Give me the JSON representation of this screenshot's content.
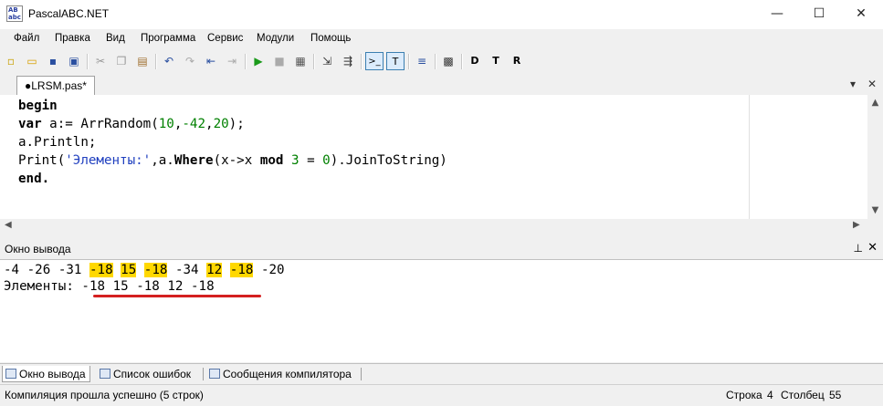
{
  "window": {
    "app_icon_text": "AB abc",
    "title": "PascalABC.NET",
    "minimize_glyph": "—",
    "maximize_glyph": "☐",
    "close_glyph": "✕"
  },
  "menu": [
    "Файл",
    "Правка",
    "Вид",
    "Программа",
    "Сервис",
    "Модули",
    "Помощь"
  ],
  "toolbar": {
    "buttons": [
      {
        "name": "new-file-icon",
        "glyph": "▫"
      },
      {
        "name": "open-file-icon",
        "glyph": "▭"
      },
      {
        "name": "save-icon",
        "glyph": "▪"
      },
      {
        "name": "save-all-icon",
        "glyph": "▣"
      },
      {
        "name": "cut-icon",
        "glyph": "✂"
      },
      {
        "name": "copy-icon",
        "glyph": "❐"
      },
      {
        "name": "paste-icon",
        "glyph": "▤"
      },
      {
        "name": "undo-icon",
        "glyph": "↶"
      },
      {
        "name": "redo-icon",
        "glyph": "↷"
      },
      {
        "name": "navigate-back-icon",
        "glyph": "⇤"
      },
      {
        "name": "navigate-forward-icon",
        "glyph": "⇥"
      },
      {
        "name": "run-icon",
        "glyph": "▶"
      },
      {
        "name": "stop-icon",
        "glyph": "■"
      },
      {
        "name": "compile-icon",
        "glyph": "▦"
      },
      {
        "name": "debug-step-icon",
        "glyph": "⇲"
      },
      {
        "name": "debug-step-over-icon",
        "glyph": "⇶"
      },
      {
        "name": "console-output-icon",
        "glyph": ">_"
      },
      {
        "name": "text-output-icon",
        "glyph": "T"
      },
      {
        "name": "format-code-icon",
        "glyph": "≡"
      },
      {
        "name": "form-designer-icon",
        "glyph": "▩"
      },
      {
        "name": "file-d-icon",
        "glyph": "D"
      },
      {
        "name": "file-t-icon",
        "glyph": "T"
      },
      {
        "name": "file-r-icon",
        "glyph": "R"
      }
    ]
  },
  "editor_tab": {
    "label": "●LRSM.pas*",
    "scroll_glyph": "▾",
    "close_glyph": "✕"
  },
  "code": [
    "begin",
    "var a:= ArrRandom(10,-42,20);",
    "a.Println;",
    "Print('Элементы:',a.Where(x->x mod 3 = 0).JoinToString)",
    "end."
  ],
  "output_panel": {
    "title": "Окно вывода",
    "pin_glyph": "⊥",
    "close_glyph": "✕"
  },
  "output": {
    "numbers": [
      {
        "text": "-4",
        "divisible": false
      },
      {
        "text": "-26",
        "divisible": false
      },
      {
        "text": "-31",
        "divisible": false
      },
      {
        "text": "-18",
        "divisible": true
      },
      {
        "text": "15",
        "divisible": true
      },
      {
        "text": "-18",
        "divisible": true
      },
      {
        "text": "-34",
        "divisible": false
      },
      {
        "text": "12",
        "divisible": true
      },
      {
        "text": "-18",
        "divisible": true
      },
      {
        "text": "-20",
        "divisible": false
      }
    ],
    "result_label": "Элементы:",
    "result_values": "-18 15 -18 12 -18"
  },
  "bottom_tabs": [
    "Окно вывода",
    "Список ошибок",
    "Сообщения компилятора"
  ],
  "status": {
    "message": "Компиляция прошла успешно (5 строк)",
    "line_label": "Строка",
    "line": "4",
    "col_label": "Столбец",
    "col": "55"
  },
  "colors": {
    "highlight": "#ffd800",
    "underline": "#d42020",
    "string": "#1f3fbf",
    "number": "#008000"
  }
}
